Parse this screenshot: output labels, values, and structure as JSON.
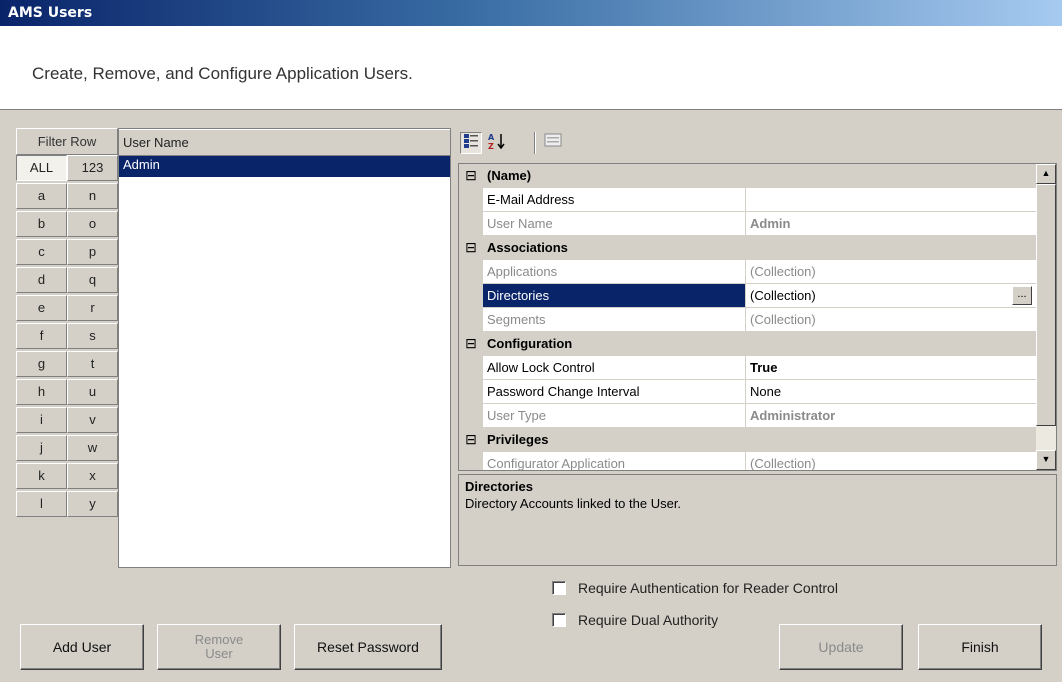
{
  "window": {
    "title": "AMS Users"
  },
  "header": {
    "description": "Create, Remove, and Configure Application Users."
  },
  "filter": {
    "header": "Filter Row",
    "buttons": [
      [
        "ALL",
        "123"
      ],
      [
        "a",
        "n"
      ],
      [
        "b",
        "o"
      ],
      [
        "c",
        "p"
      ],
      [
        "d",
        "q"
      ],
      [
        "e",
        "r"
      ],
      [
        "f",
        "s"
      ],
      [
        "g",
        "t"
      ],
      [
        "h",
        "u"
      ],
      [
        "i",
        "v"
      ],
      [
        "j",
        "w"
      ],
      [
        "k",
        "x"
      ],
      [
        "l",
        "y"
      ]
    ],
    "active": "ALL"
  },
  "userlist": {
    "column": "User Name",
    "rows": [
      {
        "name": "Admin",
        "selected": true
      }
    ]
  },
  "propgrid": {
    "toolbar": [
      "categorized-icon",
      "alphabetical-sort-icon",
      "property-pages-icon"
    ],
    "rows": [
      {
        "type": "cat",
        "glyph": "⊟",
        "name": "(Name)"
      },
      {
        "type": "prop",
        "name": "E-Mail Address",
        "value": ""
      },
      {
        "type": "prop",
        "name": "User Name",
        "value": "Admin",
        "readonly": true,
        "bold": true
      },
      {
        "type": "cat",
        "glyph": "⊟",
        "name": "Associations"
      },
      {
        "type": "prop",
        "name": "Applications",
        "value": "(Collection)",
        "readonly": true
      },
      {
        "type": "prop",
        "name": "Directories",
        "value": "(Collection)",
        "selected": true,
        "ellipsis": "..."
      },
      {
        "type": "prop",
        "name": "Segments",
        "value": "(Collection)",
        "readonly": true
      },
      {
        "type": "cat",
        "glyph": "⊟",
        "name": "Configuration"
      },
      {
        "type": "prop",
        "name": "Allow Lock Control",
        "value": "True",
        "bold": true
      },
      {
        "type": "prop",
        "name": "Password Change Interval",
        "value": "None"
      },
      {
        "type": "prop",
        "name": "User Type",
        "value": "Administrator",
        "readonly": true,
        "bold": true
      },
      {
        "type": "cat",
        "glyph": "⊟",
        "name": "Privileges"
      },
      {
        "type": "prop",
        "name": "Configurator Application",
        "value": "(Collection)",
        "readonly": true
      }
    ],
    "help": {
      "title": "Directories",
      "text": "Directory Accounts linked to the User."
    }
  },
  "options": {
    "require_auth": "Require Authentication for Reader Control",
    "require_dual": "Require Dual Authority"
  },
  "buttons": {
    "add_user": "Add User",
    "remove_user_line1": "Remove",
    "remove_user_line2": "User",
    "reset_password": "Reset Password",
    "update": "Update",
    "finish": "Finish"
  }
}
